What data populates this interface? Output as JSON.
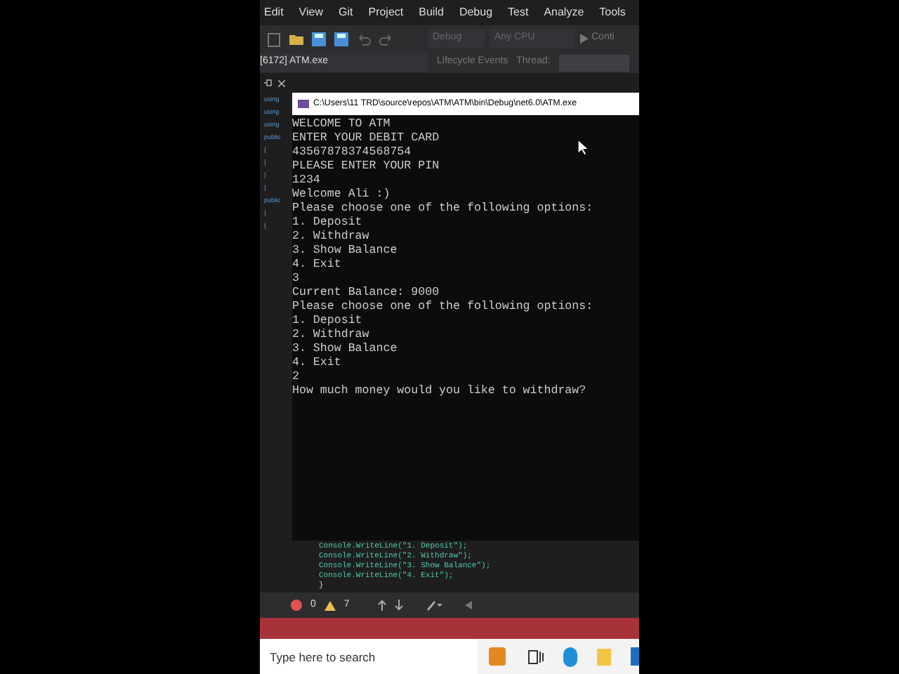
{
  "menu": [
    "Edit",
    "View",
    "Git",
    "Project",
    "Build",
    "Debug",
    "Test",
    "Analyze",
    "Tools"
  ],
  "toolbar": {
    "configuration": "Debug",
    "platform": "Any CPU",
    "run": "Conti"
  },
  "debug_bar": {
    "process": "[6172] ATM.exe",
    "lifecycle": "Lifecycle Events",
    "thread": "Thread:"
  },
  "gutter": [
    "using",
    "using",
    "using",
    "public",
    "{",
    "{",
    "}",
    "}",
    "public",
    "{",
    "{"
  ],
  "console": {
    "title": "C:\\Users\\11 TRD\\source\\repos\\ATM\\ATM\\bin\\Debug\\net6.0\\ATM.exe",
    "lines": [
      "WELCOME TO ATM",
      "ENTER YOUR DEBIT CARD",
      "43567878374568754",
      "PLEASE ENTER YOUR PIN",
      "1234",
      "Welcome Ali :)",
      "Please choose one of the following options:",
      "1. Deposit",
      "2. Withdraw",
      "3. Show Balance",
      "4. Exit",
      "3",
      "Current Balance: 9000",
      "Please choose one of the following options:",
      "1. Deposit",
      "2. Withdraw",
      "3. Show Balance",
      "4. Exit",
      "2",
      "How much money would you like to withdraw?"
    ]
  },
  "code_lines": [
    "Console.WriteLine(\"1. Deposit\");",
    "Console.WriteLine(\"2. Withdraw\");",
    "Console.WriteLine(\"3. Show Balance\");",
    "Console.WriteLine(\"4. Exit\");"
  ],
  "code_close": "}",
  "status_bar": {
    "errors": "0",
    "warnings": "7"
  },
  "taskbar": {
    "search_placeholder": "Type here to search"
  }
}
